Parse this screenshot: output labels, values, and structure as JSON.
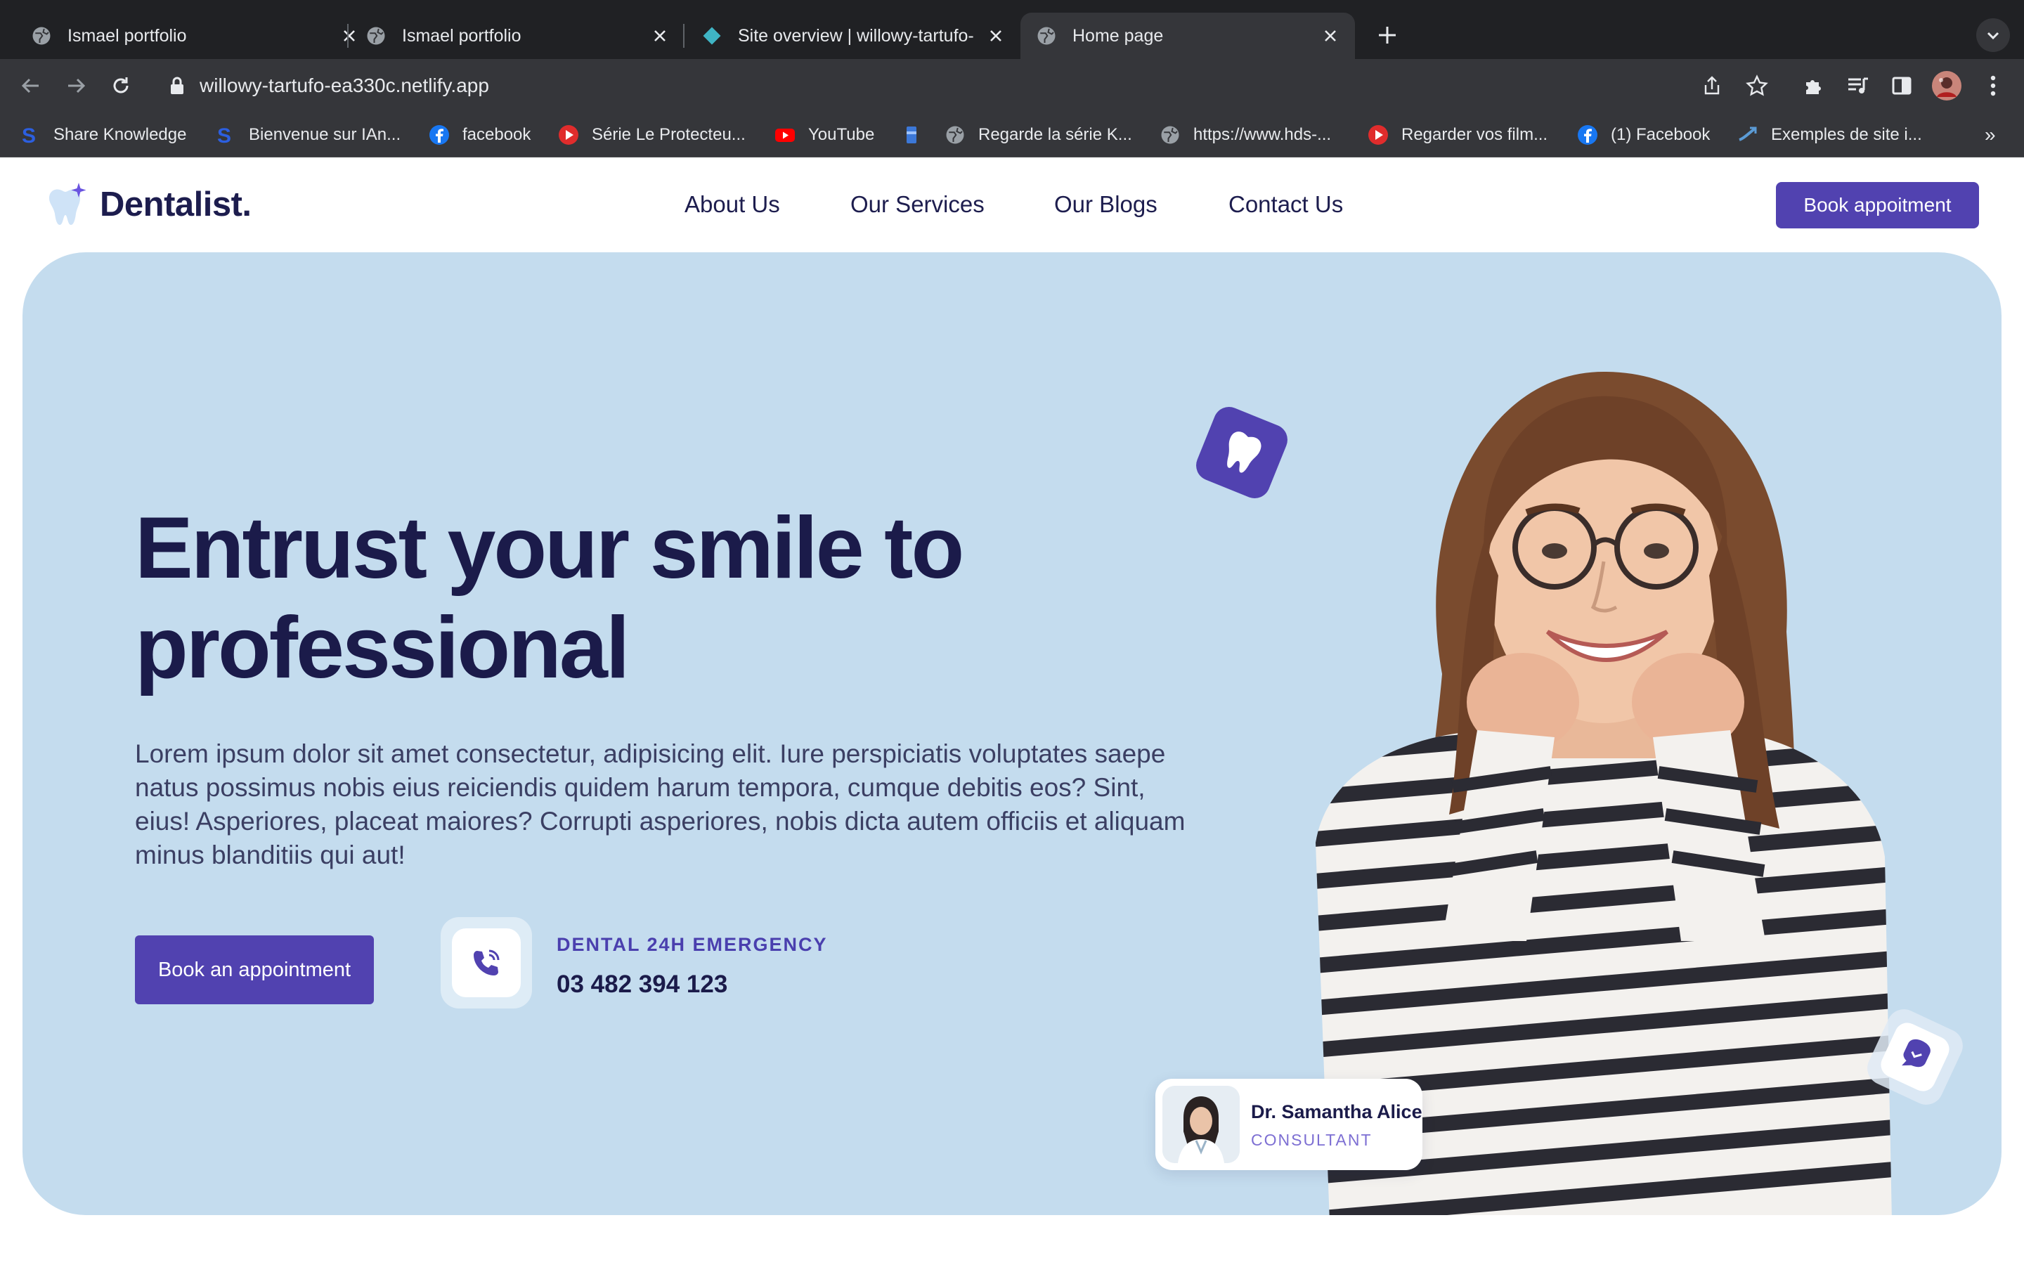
{
  "browser": {
    "tabs": [
      {
        "title": "Ismael portfolio",
        "icon": "globe-icon",
        "active": false
      },
      {
        "title": "Ismael portfolio",
        "icon": "globe-icon",
        "active": false
      },
      {
        "title": "Site overview | willowy-tartufo-",
        "icon": "netlify-icon",
        "active": false
      },
      {
        "title": "Home page",
        "icon": "globe-icon",
        "active": true
      }
    ],
    "url": "willowy-tartufo-ea330c.netlify.app",
    "bookmarks": [
      {
        "label": "Share Knowledge",
        "icon": "s-logo-icon"
      },
      {
        "label": "Bienvenue sur IAn...",
        "icon": "s-logo-icon"
      },
      {
        "label": "facebook",
        "icon": "facebook-icon"
      },
      {
        "label": "Série Le Protecteu...",
        "icon": "play-icon"
      },
      {
        "label": "YouTube",
        "icon": "youtube-icon"
      },
      {
        "label": "",
        "icon": "bookmark-tag-icon"
      },
      {
        "label": "Regarde la série K...",
        "icon": "globe-icon"
      },
      {
        "label": "https://www.hds-...",
        "icon": "globe-icon"
      },
      {
        "label": "Regarder vos film...",
        "icon": "play-icon"
      },
      {
        "label": "(1) Facebook",
        "icon": "facebook-icon"
      },
      {
        "label": "Exemples de site i...",
        "icon": "arrow-icon"
      }
    ],
    "more_bookmarks": "»"
  },
  "site": {
    "brand": "Dentalist.",
    "nav": {
      "about": "About Us",
      "services": "Our Services",
      "blogs": "Our Blogs",
      "contact": "Contact Us"
    },
    "book_button": "Book appoitment",
    "hero": {
      "headline": "Entrust your smile to professional",
      "paragraph": "Lorem ipsum dolor sit amet consectetur, adipisicing elit. Iure perspiciatis voluptates saepe natus possimus nobis eius reiciendis quidem harum tempora, cumque debitis eos? Sint, eius! Asperiores, placeat maiores? Corrupti asperiores, nobis dicta autem officiis et aliquam minus blanditiis qui aut!",
      "cta": "Book an appointment",
      "emergency_label": "DENTAL 24H EMERGENCY",
      "emergency_phone": "03 482 394 123"
    },
    "doctor": {
      "name": "Dr. Samantha Alice",
      "role": "CONSULTANT"
    }
  },
  "colors": {
    "accent": "#5142b0",
    "hero_bg": "#c4dcee",
    "heading": "#1b1b4a",
    "chrome_dark": "#202124",
    "chrome_toolbar": "#35363a"
  }
}
